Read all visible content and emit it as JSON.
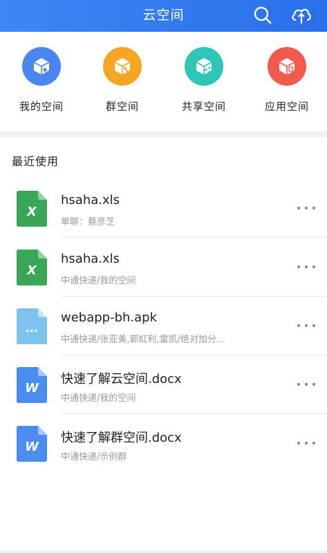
{
  "header": {
    "title": "云空间"
  },
  "spaces": [
    {
      "label": "我的空间",
      "color": "#4a86f0"
    },
    {
      "label": "群空间",
      "color": "#f5a623"
    },
    {
      "label": "共享空间",
      "color": "#2ec4b6"
    },
    {
      "label": "应用空间",
      "color": "#f25a4e"
    }
  ],
  "recent": {
    "title": "最近使用",
    "files": [
      {
        "name": "hsaha.xls",
        "sub": "单聊：蔡彦芝",
        "type": "excel",
        "badge": "X"
      },
      {
        "name": "hsaha.xls",
        "sub": "中通快递/我的空间",
        "type": "excel",
        "badge": "X"
      },
      {
        "name": "webapp-bh.apk",
        "sub": "中通快递/张亚美,郭虹利,雷凯/绝对加分...",
        "type": "other",
        "badge": "..."
      },
      {
        "name": "快速了解云空间.docx",
        "sub": "中通快递/我的空间",
        "type": "word",
        "badge": "W"
      },
      {
        "name": "快速了解群空间.docx",
        "sub": "中通快递/示例群",
        "type": "word",
        "badge": "W"
      }
    ]
  },
  "colors": {
    "header": "#3d87f5",
    "excel": "#3aa657",
    "word": "#4a8cf0",
    "other": "#7ec3ec"
  }
}
